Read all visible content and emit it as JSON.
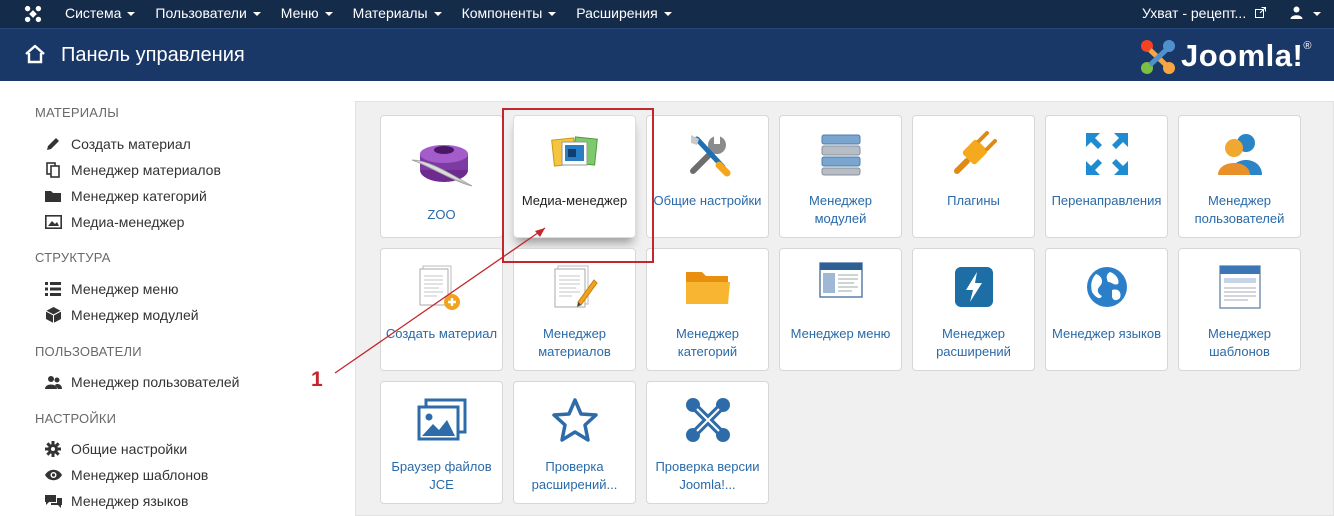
{
  "topnav": {
    "menu": [
      "Система",
      "Пользователи",
      "Меню",
      "Материалы",
      "Компоненты",
      "Расширения"
    ],
    "site_link": "Ухват - рецепт..."
  },
  "header": {
    "title": "Панель управления",
    "brand": "Joomla!"
  },
  "sidebar": {
    "sections": [
      {
        "title": "МАТЕРИАЛЫ",
        "items": [
          "Создать материал",
          "Менеджер материалов",
          "Менеджер категорий",
          "Медиа-менеджер"
        ]
      },
      {
        "title": "СТРУКТУРА",
        "items": [
          "Менеджер меню",
          "Менеджер модулей"
        ]
      },
      {
        "title": "ПОЛЬЗОВАТЕЛИ",
        "items": [
          "Менеджер пользователей"
        ]
      },
      {
        "title": "НАСТРОЙКИ",
        "items": [
          "Общие настройки",
          "Менеджер шаблонов",
          "Менеджер языков"
        ]
      }
    ]
  },
  "tiles": [
    {
      "label": "ZOO",
      "icon": "inkwell-icon"
    },
    {
      "label": "Медиа-менеджер",
      "icon": "media-icon"
    },
    {
      "label": "Общие настройки",
      "icon": "tools-icon"
    },
    {
      "label": "Менеджер модулей",
      "icon": "modules-icon"
    },
    {
      "label": "Плагины",
      "icon": "plugin-icon"
    },
    {
      "label": "Перенаправления",
      "icon": "redirect-icon"
    },
    {
      "label": "Менеджер пользователей",
      "icon": "users-icon"
    },
    {
      "label": "Создать материал",
      "icon": "new-article-icon"
    },
    {
      "label": "Менеджер материалов",
      "icon": "articles-icon"
    },
    {
      "label": "Менеджер категорий",
      "icon": "folder-icon"
    },
    {
      "label": "Менеджер меню",
      "icon": "menu-icon"
    },
    {
      "label": "Менеджер расширений",
      "icon": "extensions-icon"
    },
    {
      "label": "Менеджер языков",
      "icon": "globe-icon"
    },
    {
      "label": "Менеджер шаблонов",
      "icon": "templates-icon"
    },
    {
      "label": "Браузер файлов JCE",
      "icon": "image-browser-icon"
    },
    {
      "label": "Проверка расширений...",
      "icon": "star-icon"
    },
    {
      "label": "Проверка версии Joomla!...",
      "icon": "joomla-icon"
    }
  ],
  "annotation": {
    "number": "1"
  },
  "colors": {
    "topnav": "#152b4a",
    "header": "#1a3867",
    "link": "#2a6aa8",
    "highlight": "#c3262b"
  }
}
